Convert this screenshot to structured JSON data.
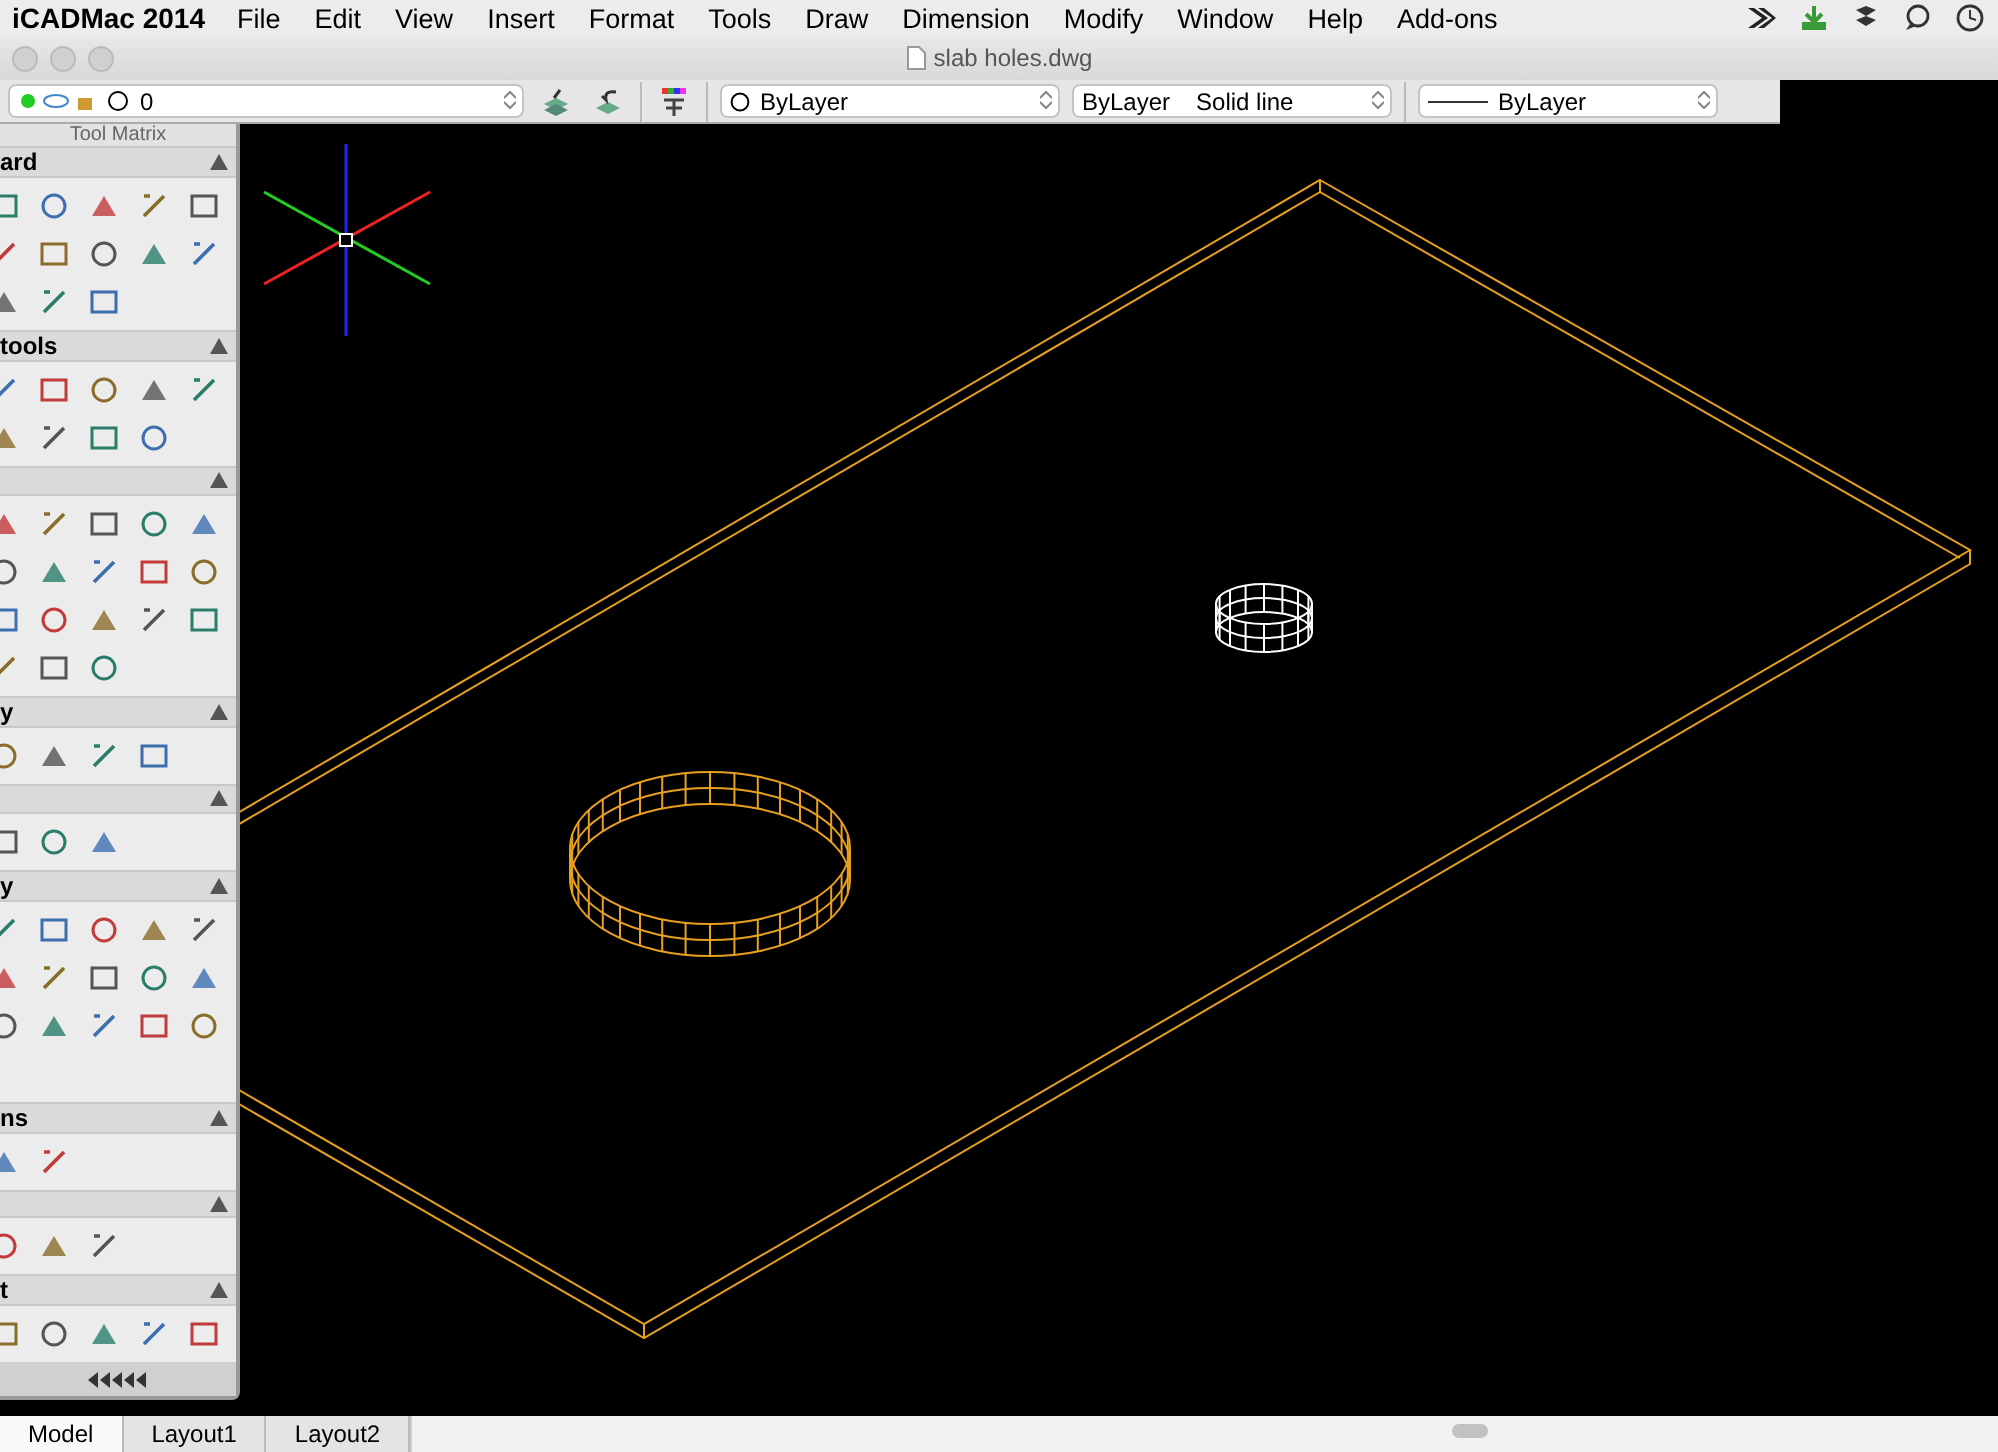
{
  "menu_bar": {
    "app_name": "iCADMac 2014",
    "items": [
      "File",
      "Edit",
      "View",
      "Insert",
      "Format",
      "Tools",
      "Draw",
      "Dimension",
      "Modify",
      "Window",
      "Help",
      "Add-ons"
    ]
  },
  "document": {
    "title": "slab holes.dwg"
  },
  "toolbar": {
    "layer": "0",
    "color_setting": "ByLayer",
    "linetype": "ByLayer",
    "linetype_style": "Solid line",
    "lineweight": "ByLayer"
  },
  "tool_matrix": {
    "title": "Tool Matrix",
    "sections": [
      {
        "title": "ard",
        "expanded": true
      },
      {
        "title": "tools",
        "expanded": true
      },
      {
        "expanded": true
      },
      {
        "title": "y",
        "expanded": true
      },
      {
        "expanded": true
      },
      {
        "title": "y",
        "expanded": true
      },
      {
        "title": "ns",
        "expanded": true
      },
      {
        "expanded": true
      },
      {
        "title": "t",
        "expanded": true
      }
    ]
  },
  "layout_tabs": [
    {
      "label": "Model",
      "selected": true
    },
    {
      "label": "Layout1",
      "selected": false
    },
    {
      "label": "Layout2",
      "selected": false
    }
  ]
}
